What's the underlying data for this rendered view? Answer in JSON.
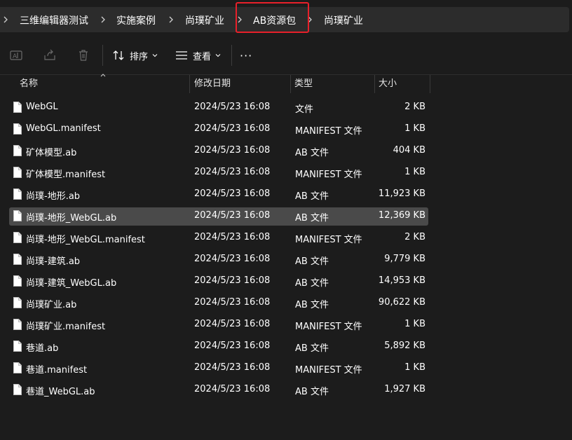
{
  "breadcrumb": {
    "items": [
      "三维编辑器测试",
      "实施案例",
      "尚璞矿业",
      "AB资源包",
      "尚璞矿业"
    ]
  },
  "toolbar": {
    "sort_label": "排序",
    "view_label": "查看",
    "more_label": "···"
  },
  "columns": {
    "name": "名称",
    "date": "修改日期",
    "type": "类型",
    "size": "大小"
  },
  "files": [
    {
      "name": "WebGL",
      "date": "2024/5/23 16:08",
      "type": "文件",
      "size": "2 KB"
    },
    {
      "name": "WebGL.manifest",
      "date": "2024/5/23 16:08",
      "type": "MANIFEST 文件",
      "size": "1 KB"
    },
    {
      "name": "矿体模型.ab",
      "date": "2024/5/23 16:08",
      "type": "AB 文件",
      "size": "404 KB"
    },
    {
      "name": "矿体模型.manifest",
      "date": "2024/5/23 16:08",
      "type": "MANIFEST 文件",
      "size": "1 KB"
    },
    {
      "name": "尚璞-地形.ab",
      "date": "2024/5/23 16:08",
      "type": "AB 文件",
      "size": "11,923 KB"
    },
    {
      "name": "尚璞-地形_WebGL.ab",
      "date": "2024/5/23 16:08",
      "type": "AB 文件",
      "size": "12,369 KB"
    },
    {
      "name": "尚璞-地形_WebGL.manifest",
      "date": "2024/5/23 16:08",
      "type": "MANIFEST 文件",
      "size": "2 KB"
    },
    {
      "name": "尚璞-建筑.ab",
      "date": "2024/5/23 16:08",
      "type": "AB 文件",
      "size": "9,779 KB"
    },
    {
      "name": "尚璞-建筑_WebGL.ab",
      "date": "2024/5/23 16:08",
      "type": "AB 文件",
      "size": "14,953 KB"
    },
    {
      "name": "尚璞矿业.ab",
      "date": "2024/5/23 16:08",
      "type": "AB 文件",
      "size": "90,622 KB"
    },
    {
      "name": "尚璞矿业.manifest",
      "date": "2024/5/23 16:08",
      "type": "MANIFEST 文件",
      "size": "1 KB"
    },
    {
      "name": "巷道.ab",
      "date": "2024/5/23 16:08",
      "type": "AB 文件",
      "size": "5,892 KB"
    },
    {
      "name": "巷道.manifest",
      "date": "2024/5/23 16:08",
      "type": "MANIFEST 文件",
      "size": "1 KB"
    },
    {
      "name": "巷道_WebGL.ab",
      "date": "2024/5/23 16:08",
      "type": "AB 文件",
      "size": "1,927 KB"
    }
  ],
  "selected_row": "尚璞-地形_WebGL.ab",
  "colors": {
    "background": "#1c1c1c",
    "address_bar": "#2c2c2c",
    "selected_row": "#4a4a4a",
    "highlight_box": "#e8202a"
  },
  "icons": {
    "toolbar": [
      "rename-icon",
      "share-icon",
      "delete-icon",
      "sort-icon",
      "view-icon",
      "more-icon"
    ],
    "file": "file-icon"
  }
}
